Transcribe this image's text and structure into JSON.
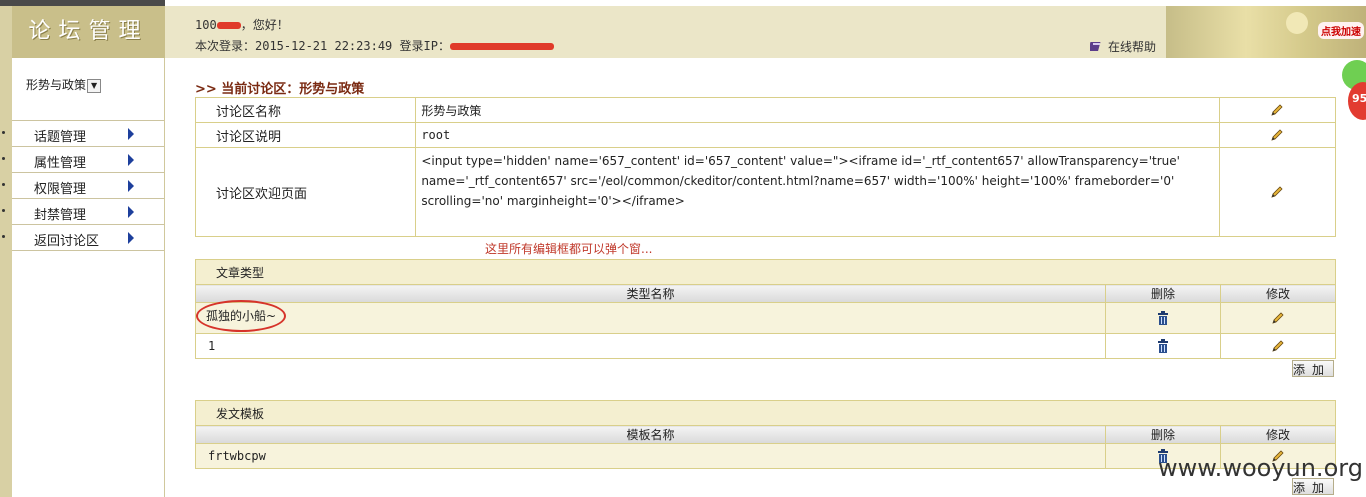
{
  "logo": {
    "title": "论坛管理"
  },
  "header": {
    "greeting_user": "100",
    "greeting_suffix": "，您好！",
    "login_label": "本次登录：2015-12-21 22:23:49 登录IP：",
    "help_link": "在线帮助",
    "promo_badge": "点我加速",
    "counter": "95"
  },
  "sidebar": {
    "forum_select": "形势与政策",
    "menu": [
      {
        "label": "话题管理"
      },
      {
        "label": "属性管理"
      },
      {
        "label": "权限管理"
      },
      {
        "label": "封禁管理"
      },
      {
        "label": "返回讨论区"
      }
    ]
  },
  "main": {
    "breadcrumb": ">> 当前讨论区：形势与政策",
    "info": {
      "rows": [
        {
          "label": "讨论区名称",
          "value": "形势与政策"
        },
        {
          "label": "讨论区说明",
          "value": "root"
        },
        {
          "label": "讨论区欢迎页面",
          "value": "<input type='hidden' name='657_content' id='657_content' value=\"><iframe id='_rtf_content657' allowTransparency='true' name='_rtf_content657' src='/eol/common/ckeditor/content.html?name=657' width='100%' height='100%' frameborder='0' scrolling='no' marginheight='0'></iframe>"
        }
      ]
    },
    "annotation": "这里所有编辑框都可以弹个窗...",
    "article_types": {
      "title": "文章类型",
      "columns": [
        "类型名称",
        "删除",
        "修改"
      ],
      "rows": [
        {
          "name": "孤独的小船~"
        },
        {
          "name": "1"
        }
      ],
      "add_label": "添加"
    },
    "templates": {
      "title": "发文模板",
      "columns": [
        "模板名称",
        "删除",
        "修改"
      ],
      "rows": [
        {
          "name": "frtwbcpw"
        }
      ],
      "add_label": "添加"
    }
  },
  "watermark": "www.wooyun.org",
  "colors": {
    "accent_header": "#ebe6c8",
    "border": "#d9cf8a",
    "breadcrumb": "#7a2a12",
    "annotation": "#c0392b",
    "menu_arrow": "#1d3f9c"
  }
}
